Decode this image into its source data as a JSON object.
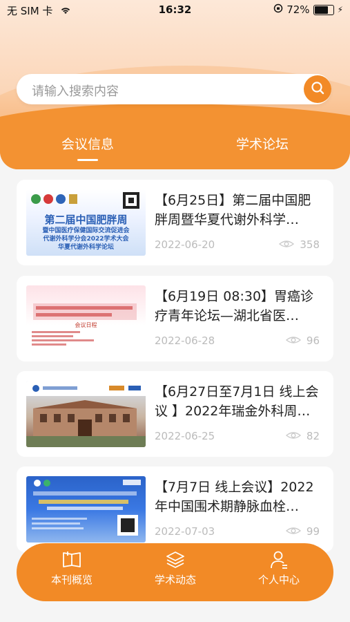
{
  "status": {
    "carrier": "无 SIM 卡",
    "time": "16:32",
    "battery": "72%"
  },
  "search": {
    "placeholder": "请输入搜索内容"
  },
  "tabs": [
    {
      "label": "会议信息",
      "active": true
    },
    {
      "label": "学术论坛",
      "active": false
    }
  ],
  "articles": [
    {
      "title": "【6月25日】第二届中国肥胖周暨华夏代谢外科学…",
      "date": "2022-06-20",
      "views": "358",
      "thumb_text": [
        "第二届中国肥胖周",
        "暨中国医疗保健国际交流促进会",
        "代谢外科学分会2022学术大会",
        "华夏代谢外科学论坛"
      ]
    },
    {
      "title": "【6月19日 08:30】胃癌诊疗青年论坛—湖北省医…",
      "date": "2022-06-28",
      "views": "96",
      "thumb_text": [
        "会议日程"
      ]
    },
    {
      "title": "【6月27日至7月1日 线上会议 】2022年瑞金外科周…",
      "date": "2022-06-25",
      "views": "82",
      "thumb_text": []
    },
    {
      "title": "【7月7日 线上会议】2022年中国围术期静脉血栓…",
      "date": "2022-07-03",
      "views": "99",
      "thumb_text": []
    }
  ],
  "tabbar": [
    {
      "label": "本刊概览",
      "icon": "book-icon"
    },
    {
      "label": "学术动态",
      "icon": "stack-icon"
    },
    {
      "label": "个人中心",
      "icon": "person-icon"
    }
  ],
  "colors": {
    "accent": "#f28a26"
  }
}
